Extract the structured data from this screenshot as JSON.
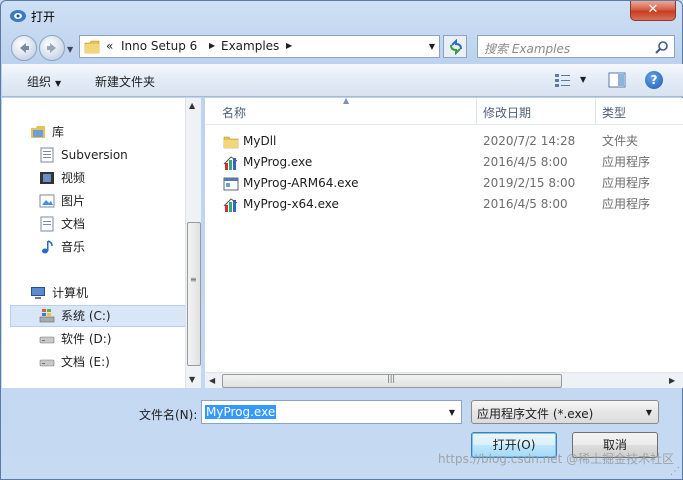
{
  "window": {
    "title": "打开"
  },
  "titlebar": {
    "close_label": "✕"
  },
  "address": {
    "overflow": "«",
    "crumbs": [
      "Inno Setup 6",
      "Examples"
    ]
  },
  "search": {
    "placeholder": "搜索 Examples"
  },
  "toolbar": {
    "organize_label": "组织",
    "new_folder_label": "新建文件夹",
    "help_label": "?"
  },
  "nav": {
    "library": "库",
    "subversion": "Subversion",
    "videos": "视频",
    "pictures": "图片",
    "documents": "文档",
    "music": "音乐",
    "computer": "计算机",
    "drive_c": "系统 (C:)",
    "drive_d": "软件 (D:)",
    "drive_e": "文档 (E:)"
  },
  "columns": {
    "name": "名称",
    "date": "修改日期",
    "type": "类型"
  },
  "files": [
    {
      "name": "MyDll",
      "date": "2020/7/2 14:28",
      "type": "文件夹",
      "icon": "folder-icon"
    },
    {
      "name": "MyProg.exe",
      "date": "2016/4/5 8:00",
      "type": "应用程序",
      "icon": "setup-exe-icon"
    },
    {
      "name": "MyProg-ARM64.exe",
      "date": "2019/2/15 8:00",
      "type": "应用程序",
      "icon": "window-exe-icon"
    },
    {
      "name": "MyProg-x64.exe",
      "date": "2016/4/5 8:00",
      "type": "应用程序",
      "icon": "setup-exe-icon"
    }
  ],
  "form": {
    "filename_label": "文件名(N):",
    "filename_value": "MyProg.exe",
    "filetype_value": "应用程序文件 (*.exe)",
    "open_label": "打开(O)",
    "cancel_label": "取消"
  },
  "watermark": "https://blog.csdn.net @稀土掘金技术社区"
}
